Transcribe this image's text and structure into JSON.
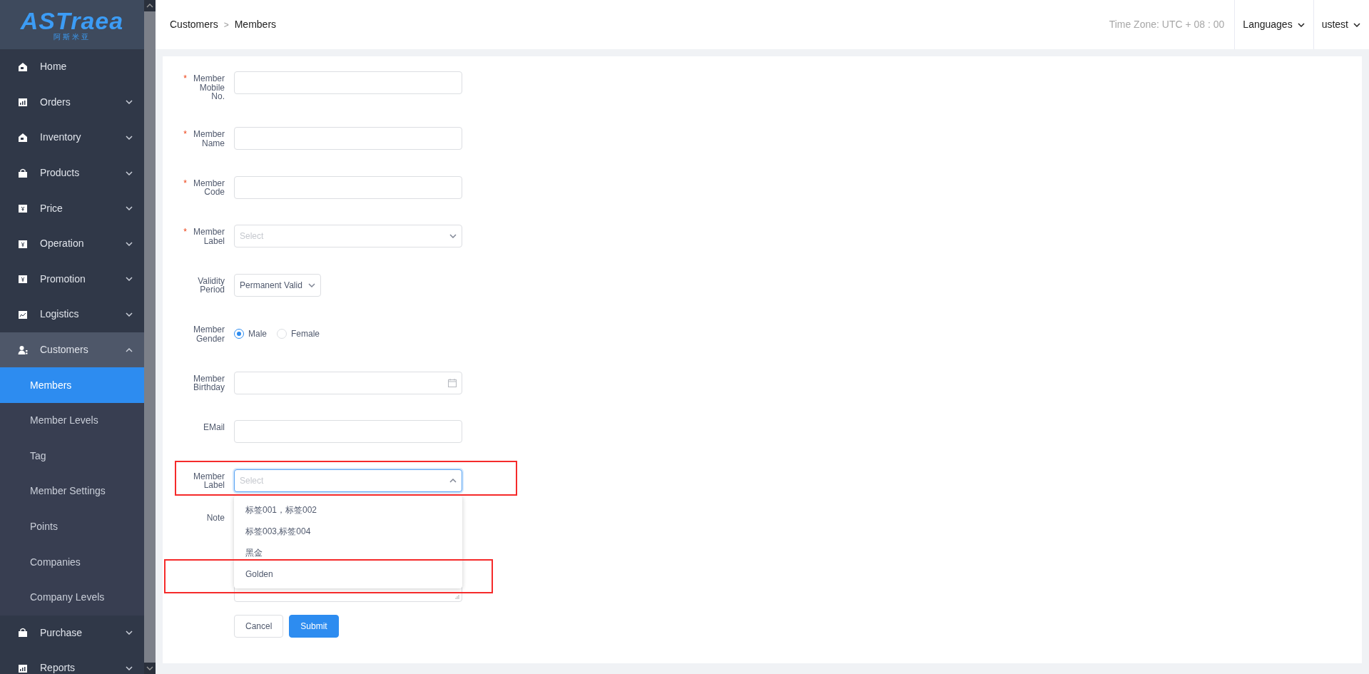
{
  "logo": {
    "text": "ASTraea",
    "subtitle": "阿斯米亚"
  },
  "sidebar": {
    "items": [
      {
        "label": "Home",
        "kind": "link"
      },
      {
        "label": "Orders",
        "kind": "group",
        "expanded": false
      },
      {
        "label": "Inventory",
        "kind": "group",
        "expanded": false
      },
      {
        "label": "Products",
        "kind": "group",
        "expanded": false
      },
      {
        "label": "Price",
        "kind": "group",
        "expanded": false
      },
      {
        "label": "Operation",
        "kind": "group",
        "expanded": false
      },
      {
        "label": "Promotion",
        "kind": "group",
        "expanded": false
      },
      {
        "label": "Logistics",
        "kind": "group",
        "expanded": false
      },
      {
        "label": "Customers",
        "kind": "group",
        "expanded": true,
        "children": [
          {
            "label": "Members",
            "selected": true
          },
          {
            "label": "Member Levels",
            "selected": false
          },
          {
            "label": "Tag",
            "selected": false
          },
          {
            "label": "Member Settings",
            "selected": false
          },
          {
            "label": "Points",
            "selected": false
          },
          {
            "label": "Companies",
            "selected": false
          },
          {
            "label": "Company Levels",
            "selected": false
          }
        ]
      },
      {
        "label": "Purchase",
        "kind": "group",
        "expanded": false
      },
      {
        "label": "Reports",
        "kind": "group",
        "expanded": false
      }
    ]
  },
  "header": {
    "breadcrumb": [
      "Customers",
      "Members"
    ],
    "breadcrumb_separator": ">",
    "timezone": "Time Zone: UTC + 08 : 00",
    "menus": [
      "Languages",
      "ustest"
    ]
  },
  "form": {
    "fields": [
      {
        "kind": "text",
        "required_mark": "*",
        "label": "Member Mobile No."
      },
      {
        "kind": "text",
        "required_mark": "*",
        "label": "Member Name"
      },
      {
        "kind": "text",
        "required_mark": "*",
        "label": "Member Code"
      },
      {
        "kind": "select",
        "required_mark": "*",
        "label": "Member Label",
        "placeholder": "Select",
        "expanded": false
      },
      {
        "kind": "select",
        "label": "Validity Period",
        "value": "Permanent Valid",
        "expanded": false
      },
      {
        "kind": "radio",
        "label": "Member Gender",
        "options": [
          {
            "label": "Male",
            "selected": true
          },
          {
            "label": "Female",
            "selected": false
          }
        ]
      },
      {
        "kind": "date",
        "label": "Member Birthday"
      },
      {
        "kind": "text",
        "label": "EMail"
      },
      {
        "kind": "select",
        "label": "Member Label",
        "placeholder": "Select",
        "expanded": true,
        "highlighted": true,
        "options": [
          {
            "label": "标签001，标签002",
            "highlighted": false
          },
          {
            "label": "标签003,标签004",
            "highlighted": false
          },
          {
            "label": "黑金",
            "highlighted": false
          },
          {
            "label": "Golden",
            "highlighted": true
          }
        ]
      },
      {
        "kind": "textarea",
        "label": "Note"
      }
    ],
    "buttons": [
      {
        "label": "Cancel",
        "kind": "secondary"
      },
      {
        "label": "Submit",
        "kind": "primary"
      }
    ]
  }
}
